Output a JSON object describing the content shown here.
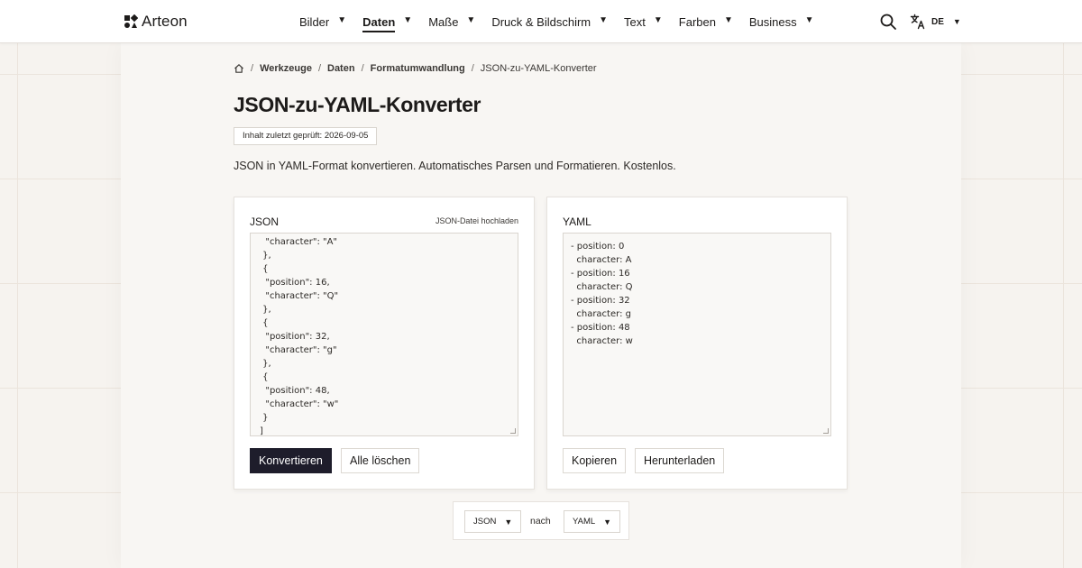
{
  "brand": {
    "name": "Arteon"
  },
  "nav": {
    "items": [
      {
        "label": "Bilder",
        "active": false
      },
      {
        "label": "Daten",
        "active": true
      },
      {
        "label": "Maße",
        "active": false
      },
      {
        "label": "Druck & Bildschirm",
        "active": false
      },
      {
        "label": "Text",
        "active": false
      },
      {
        "label": "Farben",
        "active": false
      },
      {
        "label": "Business",
        "active": false
      }
    ],
    "caret": "▼"
  },
  "header": {
    "language_code": "DE",
    "icons": {
      "search": "search-icon",
      "language": "translate-icon",
      "home": "home-icon"
    }
  },
  "breadcrumb": {
    "items": [
      "Werkzeuge",
      "Daten",
      "Formatumwandlung"
    ],
    "current": "JSON-zu-YAML-Konverter",
    "separator": "/"
  },
  "page": {
    "title": "JSON-zu-YAML-Konverter",
    "review_badge": "Inhalt zuletzt geprüft: 2026-09-05",
    "description": "JSON in YAML-Format konvertieren. Automatisches Parsen und Formatieren. Kostenlos."
  },
  "input_panel": {
    "label": "JSON",
    "upload_link": "JSON-Datei hochladen",
    "content": "  \"character\": \"A\"\n },\n {\n  \"position\": 16,\n  \"character\": \"Q\"\n },\n {\n  \"position\": 32,\n  \"character\": \"g\"\n },\n {\n  \"position\": 48,\n  \"character\": \"w\"\n }\n]",
    "convert_button": "Konvertieren",
    "clear_button": "Alle löschen"
  },
  "output_panel": {
    "label": "YAML",
    "content": "- position: 0\n  character: A\n- position: 16\n  character: Q\n- position: 32\n  character: g\n- position: 48\n  character: w",
    "copy_button": "Kopieren",
    "download_button": "Herunterladen"
  },
  "format_selector": {
    "from": "JSON",
    "connector": "nach",
    "to": "YAML"
  },
  "colors": {
    "primary_button": "#1e1d2b",
    "page_background": "#f6f3ef",
    "panel_background": "#f8f6f3",
    "text": "#1d1b1a"
  }
}
